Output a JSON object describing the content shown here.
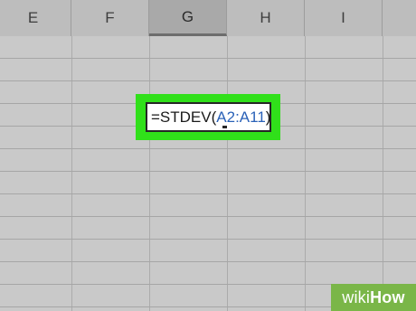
{
  "columns": [
    "E",
    "F",
    "G",
    "H",
    "I"
  ],
  "active_column": "G",
  "active_cell": {
    "formula_prefix": "=STDEV(",
    "formula_range": "A2:A11",
    "formula_suffix": ")"
  },
  "watermark": {
    "wiki": "wiki",
    "how": "How"
  },
  "colors": {
    "highlight": "#30e01a",
    "range_reference": "#2b62b8",
    "watermark_bg": "#7ab648"
  }
}
